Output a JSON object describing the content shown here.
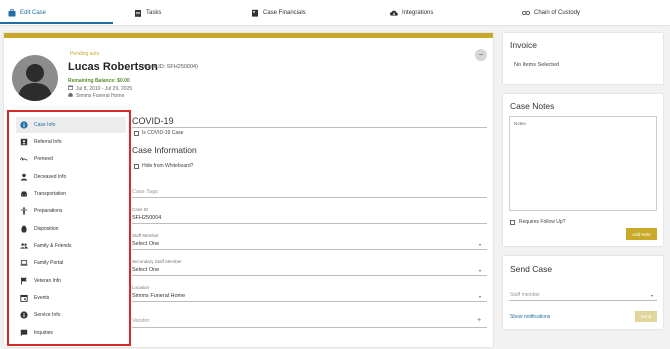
{
  "tabs": [
    {
      "label": "Edit Case",
      "icon": "briefcase-icon"
    },
    {
      "label": "Tasks",
      "icon": "clipboard-icon"
    },
    {
      "label": "Case Financials",
      "icon": "ledger-icon"
    },
    {
      "label": "Integrations",
      "icon": "cloud-download-icon"
    },
    {
      "label": "Chain of Custody",
      "icon": "link-icon"
    }
  ],
  "header": {
    "status": "Pending auto",
    "name": "Lucas Robertson",
    "case_id_text": "(Case ID: SFH250004)",
    "balance": "Remaining Balance: $0.00",
    "dates": "Jul 8, 2010 - Jul 29, 2025",
    "home": "Simms Funeral Home",
    "collapse_symbol": "−"
  },
  "menu": [
    {
      "label": "Case Info",
      "icon": "info-icon"
    },
    {
      "label": "Referral Info",
      "icon": "contact-card-icon"
    },
    {
      "label": "Preneed",
      "icon": "signature-icon"
    },
    {
      "label": "Deceased Info",
      "icon": "person-icon"
    },
    {
      "label": "Transportation",
      "icon": "car-icon"
    },
    {
      "label": "Preparations",
      "icon": "accessibility-icon"
    },
    {
      "label": "Disposition",
      "icon": "urn-icon"
    },
    {
      "label": "Family & Friends",
      "icon": "people-icon"
    },
    {
      "label": "Family Portal",
      "icon": "laptop-icon"
    },
    {
      "label": "Veteran Info",
      "icon": "flag-icon"
    },
    {
      "label": "Events",
      "icon": "calendar-icon"
    },
    {
      "label": "Service Info",
      "icon": "info-icon"
    },
    {
      "label": "Inquiries",
      "icon": "chat-icon"
    }
  ],
  "form": {
    "covid_title": "COVID-19",
    "covid_checkbox": "Is COVID-19 Case",
    "section_title": "Case Information",
    "hide_checkbox": "Hide from Whiteboard?",
    "case_tags_placeholder": "Case Tags",
    "case_id_label": "Case ID",
    "case_id_value": "SFH250004",
    "staff_label": "Staff Member",
    "staff_value": "Select One",
    "secondary_label": "Secondary Staff Member",
    "secondary_value": "Select One",
    "location_label": "Location",
    "location_value": "Simms Funeral Home",
    "vendor_placeholder": "Vendor",
    "vendor_add_symbol": "+"
  },
  "invoice": {
    "title": "Invoice",
    "empty_text": "No Items Selected"
  },
  "notes": {
    "title": "Case Notes",
    "notes_label": "Notes",
    "follow_up": "Requires Follow Up?",
    "add_button": "Add Note"
  },
  "send": {
    "title": "Send Case",
    "staff_placeholder": "Staff member",
    "show_notifications": "Show notifications",
    "send_button": "Send"
  },
  "colors": {
    "accent_blue": "#1c6ea4",
    "gold": "#c9a92a",
    "highlight_red": "#d42a2a",
    "balance_green": "#5b8e2a"
  }
}
